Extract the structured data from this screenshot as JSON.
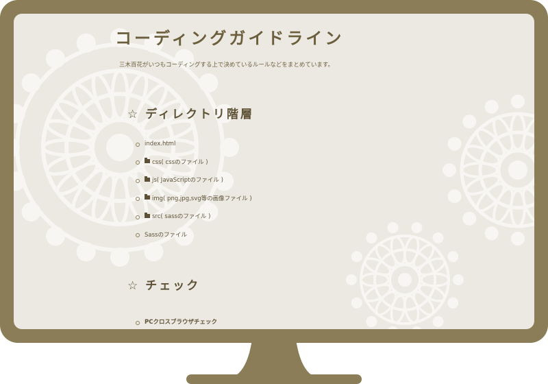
{
  "page": {
    "title": "コーディングガイドライン",
    "description": "三木百花がいつもコーディングする上で決めているルールなどをまとめています。"
  },
  "sections": [
    {
      "heading": "ディレクトリ階層",
      "star": "☆",
      "items": [
        {
          "label": "index.html",
          "icon": ""
        },
        {
          "label": "css( cssのファイル )",
          "icon": "folder-icon"
        },
        {
          "label": "js( JavaScriptのファイル )",
          "icon": "folder-icon"
        },
        {
          "label": "img( png,jpg,svg等の画像ファイル )",
          "icon": "folder-icon"
        },
        {
          "label": "src( sassのファイル )",
          "icon": "folder-icon"
        },
        {
          "label": "Sassのファイル",
          "icon": ""
        }
      ]
    },
    {
      "heading": "チェック",
      "star": "☆",
      "items": [
        {
          "label": "PCクロスブラウザチェック",
          "icon": ""
        }
      ]
    }
  ],
  "colors": {
    "frame": "#8a7d57",
    "screen": "#ece9e3",
    "text": "#5e5236",
    "doily": "#f7f6f2"
  }
}
